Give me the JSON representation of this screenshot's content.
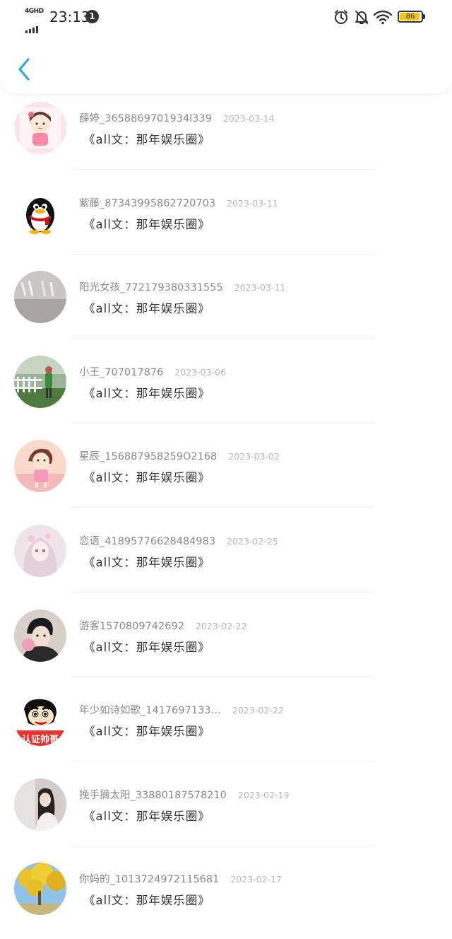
{
  "status_bar": {
    "network": "4GHD",
    "time": "23:13",
    "notification_count": "1",
    "battery_level": "86",
    "icons": [
      "alarm-icon",
      "bell-off-icon",
      "wifi-icon",
      "battery-icon"
    ]
  },
  "header": {
    "back_icon": "chevron-left-icon",
    "accent_color": "#2fa3e6"
  },
  "items": [
    {
      "name": "薛婷_3658869701934l339",
      "date": "2023-03-14",
      "title": "《all文：那年娱乐圈》",
      "avatar": "pink-cartoon-girl"
    },
    {
      "name": "紫藤_87343995862720703",
      "date": "2023-03-11",
      "title": "《all文：那年娱乐圈》",
      "avatar": "qq-penguin"
    },
    {
      "name": "阳光女孩_772179380331555",
      "date": "2023-03-11",
      "title": "《all文：那年娱乐圈》",
      "avatar": "grey-photo"
    },
    {
      "name": "小王_707017876",
      "date": "2023-03-06",
      "title": "《all文：那年娱乐圈》",
      "avatar": "fence-photo"
    },
    {
      "name": "星辰_156887958259O2168",
      "date": "2023-03-02",
      "title": "《all文：那年娱乐圈》",
      "avatar": "pink-cartoon-girl-2"
    },
    {
      "name": "恋语_41895776628484983",
      "date": "2023-02-25",
      "title": "《all文：那年娱乐圈》",
      "avatar": "anime-girl"
    },
    {
      "name": "游客1570809742692",
      "date": "2023-02-22",
      "title": "《all文：那年娱乐圈》",
      "avatar": "person-photo"
    },
    {
      "name": "年少如诗如歌_1417697133…",
      "date": "2023-02-22",
      "title": "《all文：那年娱乐圈》",
      "avatar": "crayon-shin-chan",
      "avatar_text": "认证帅哥"
    },
    {
      "name": "挽手摘太阳_33880187578210",
      "date": "2023-02-19",
      "title": "《all文：那年娱乐圈》",
      "avatar": "girl-photo"
    },
    {
      "name": "你妈的_1013724972115681",
      "date": "2023-02-17",
      "title": "《all文：那年娱乐圈》",
      "avatar": "yellow-tree-photo"
    }
  ]
}
